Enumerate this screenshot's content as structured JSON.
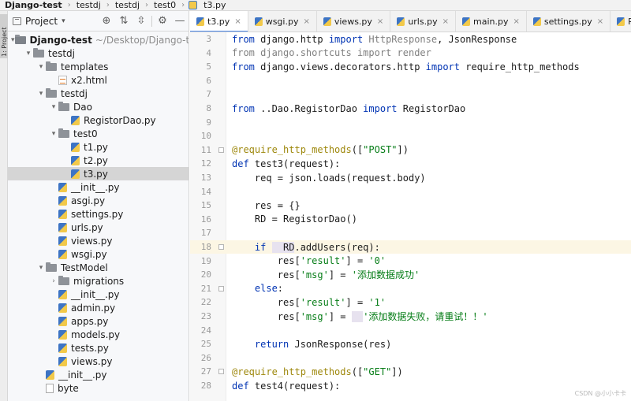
{
  "breadcrumb": {
    "items": [
      "Django-test",
      "testdj",
      "testdj",
      "test0",
      "t3.py"
    ]
  },
  "side_strip": {
    "label": "1: Project"
  },
  "project_panel": {
    "title": "Project",
    "tree": [
      {
        "label": "Django-test",
        "path": "~/Desktop/Django-test",
        "type": "folder",
        "level": 0,
        "expanded": true,
        "bold": true
      },
      {
        "label": "testdj",
        "type": "folder",
        "level": 1,
        "expanded": true
      },
      {
        "label": "templates",
        "type": "folder",
        "level": 2,
        "expanded": true
      },
      {
        "label": "x2.html",
        "type": "html",
        "level": 3
      },
      {
        "label": "testdj",
        "type": "folder",
        "level": 2,
        "expanded": true
      },
      {
        "label": "Dao",
        "type": "folder",
        "level": 3,
        "expanded": true
      },
      {
        "label": "RegistorDao.py",
        "type": "py",
        "level": 4
      },
      {
        "label": "test0",
        "type": "folder",
        "level": 3,
        "expanded": true
      },
      {
        "label": "t1.py",
        "type": "py",
        "level": 4
      },
      {
        "label": "t2.py",
        "type": "py",
        "level": 4
      },
      {
        "label": "t3.py",
        "type": "py",
        "level": 4,
        "selected": true
      },
      {
        "label": "__init__.py",
        "type": "py",
        "level": 3
      },
      {
        "label": "asgi.py",
        "type": "py",
        "level": 3
      },
      {
        "label": "settings.py",
        "type": "py",
        "level": 3
      },
      {
        "label": "urls.py",
        "type": "py",
        "level": 3
      },
      {
        "label": "views.py",
        "type": "py",
        "level": 3
      },
      {
        "label": "wsgi.py",
        "type": "py",
        "level": 3
      },
      {
        "label": "TestModel",
        "type": "folder",
        "level": 2,
        "expanded": true
      },
      {
        "label": "migrations",
        "type": "folder",
        "level": 3,
        "expanded": false
      },
      {
        "label": "__init__.py",
        "type": "py",
        "level": 3
      },
      {
        "label": "admin.py",
        "type": "py",
        "level": 3
      },
      {
        "label": "apps.py",
        "type": "py",
        "level": 3
      },
      {
        "label": "models.py",
        "type": "py",
        "level": 3
      },
      {
        "label": "tests.py",
        "type": "py",
        "level": 3
      },
      {
        "label": "views.py",
        "type": "py",
        "level": 3
      },
      {
        "label": "__init__.py",
        "type": "py",
        "level": 2
      },
      {
        "label": "byte",
        "type": "txt",
        "level": 2
      }
    ]
  },
  "tabs": [
    {
      "label": "t3.py",
      "active": true
    },
    {
      "label": "wsgi.py"
    },
    {
      "label": "views.py"
    },
    {
      "label": "urls.py"
    },
    {
      "label": "main.py"
    },
    {
      "label": "settings.py"
    },
    {
      "label": "RegistorDao.py"
    }
  ],
  "editor": {
    "current_line": 18,
    "lines": [
      {
        "n": 3,
        "tokens": [
          [
            "kw",
            "from "
          ],
          [
            "nm",
            "django.http "
          ],
          [
            "kw",
            "import "
          ],
          [
            "dim",
            "HttpResponse"
          ],
          [
            "nm",
            ", JsonResponse"
          ]
        ]
      },
      {
        "n": 4,
        "tokens": [
          [
            "dim",
            "from django.shortcuts import render"
          ]
        ]
      },
      {
        "n": 5,
        "tokens": [
          [
            "kw",
            "from "
          ],
          [
            "nm",
            "django.views.decorators.http "
          ],
          [
            "kw",
            "import "
          ],
          [
            "nm",
            "require_http_methods"
          ]
        ]
      },
      {
        "n": 6,
        "tokens": []
      },
      {
        "n": 7,
        "tokens": []
      },
      {
        "n": 8,
        "tokens": [
          [
            "kw",
            "from "
          ],
          [
            "nm",
            "..Dao.RegistorDao "
          ],
          [
            "kw",
            "import "
          ],
          [
            "nm",
            "RegistorDao"
          ]
        ]
      },
      {
        "n": 9,
        "tokens": []
      },
      {
        "n": 10,
        "tokens": []
      },
      {
        "n": 11,
        "tokens": [
          [
            "dec",
            "@require_http_methods"
          ],
          [
            "nm",
            "(["
          ],
          [
            "str",
            "\"POST\""
          ],
          [
            "nm",
            "])"
          ]
        ]
      },
      {
        "n": 12,
        "tokens": [
          [
            "kw",
            "def "
          ],
          [
            "nm",
            "test3(request):"
          ]
        ]
      },
      {
        "n": 13,
        "tokens": [
          [
            "nm",
            "    req = json.loads(request.body)"
          ]
        ]
      },
      {
        "n": 14,
        "tokens": []
      },
      {
        "n": 15,
        "tokens": [
          [
            "nm",
            "    res = {}"
          ]
        ]
      },
      {
        "n": 16,
        "tokens": [
          [
            "nm",
            "    RD = RegistorDao()"
          ]
        ]
      },
      {
        "n": 17,
        "tokens": []
      },
      {
        "n": 18,
        "tokens": [
          [
            "kw",
            "    if "
          ],
          [
            "mark",
            "  RD"
          ],
          [
            "nm",
            ".addUsers(req):"
          ]
        ]
      },
      {
        "n": 19,
        "tokens": [
          [
            "nm",
            "        res["
          ],
          [
            "str",
            "'result'"
          ],
          [
            "nm",
            "] = "
          ],
          [
            "str",
            "'0'"
          ]
        ]
      },
      {
        "n": 20,
        "tokens": [
          [
            "nm",
            "        res["
          ],
          [
            "str",
            "'msg'"
          ],
          [
            "nm",
            "] = "
          ],
          [
            "str",
            "'添加数据成功'"
          ]
        ]
      },
      {
        "n": 21,
        "tokens": [
          [
            "kw",
            "    else"
          ],
          [
            "nm",
            ":"
          ]
        ]
      },
      {
        "n": 22,
        "tokens": [
          [
            "nm",
            "        res["
          ],
          [
            "str",
            "'result'"
          ],
          [
            "nm",
            "] = "
          ],
          [
            "str",
            "'1'"
          ]
        ]
      },
      {
        "n": 23,
        "tokens": [
          [
            "nm",
            "        res["
          ],
          [
            "str",
            "'msg'"
          ],
          [
            "nm",
            "] = "
          ],
          [
            "mark",
            "  "
          ],
          [
            "str",
            "'添加数据失败，请重试！！'"
          ]
        ]
      },
      {
        "n": 24,
        "tokens": []
      },
      {
        "n": 25,
        "tokens": [
          [
            "kw",
            "    return "
          ],
          [
            "nm",
            "JsonResponse(res)"
          ]
        ]
      },
      {
        "n": 26,
        "tokens": []
      },
      {
        "n": 27,
        "tokens": [
          [
            "dec",
            "@require_http_methods"
          ],
          [
            "nm",
            "(["
          ],
          [
            "str",
            "\"GET\""
          ],
          [
            "nm",
            "])"
          ]
        ]
      },
      {
        "n": 28,
        "tokens": [
          [
            "kw",
            "def "
          ],
          [
            "nm",
            "test4(request):"
          ]
        ]
      }
    ]
  },
  "watermark": "CSDN @小小卡卡"
}
